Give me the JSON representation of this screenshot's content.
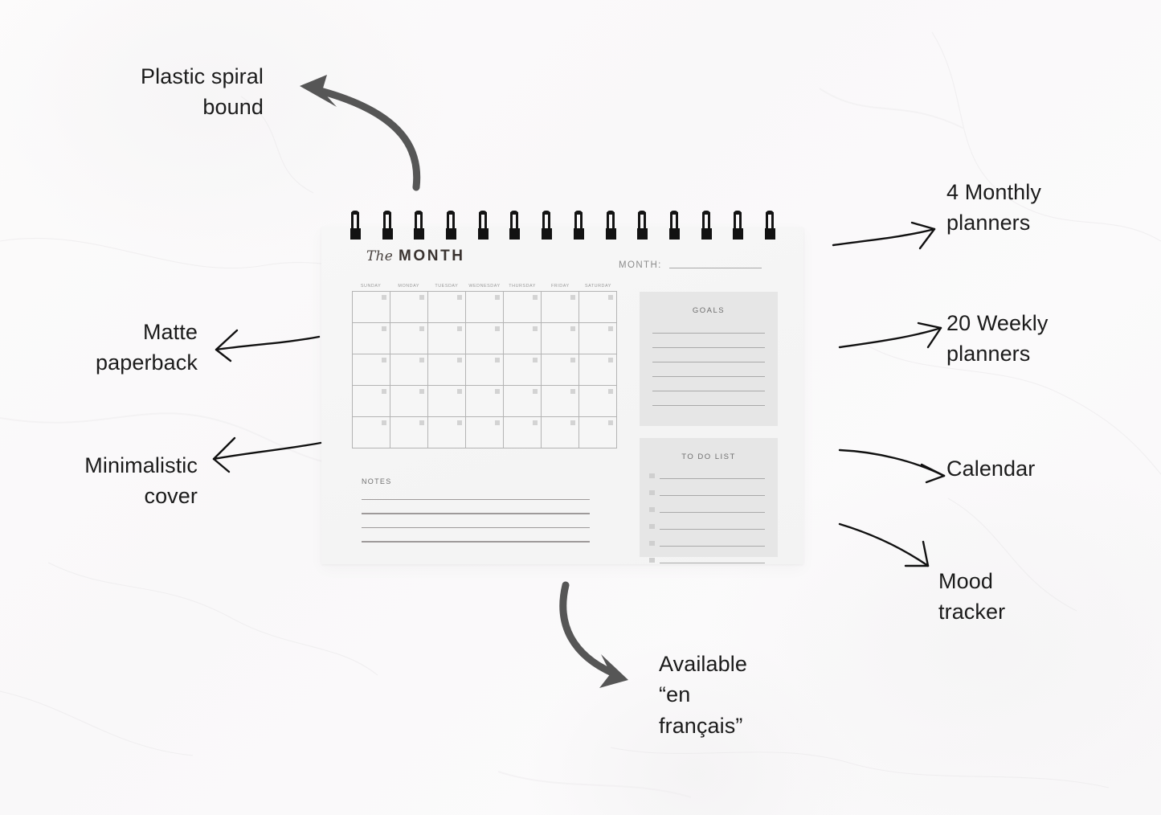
{
  "page": {
    "background_color": "#fbfafa",
    "card_background": "#f5f5f5",
    "panel_background": "#e6e6e6",
    "ink_color": "#1b1b1b",
    "thick_arrow_color": "#565656",
    "thin_arrow_color": "#111111"
  },
  "planner": {
    "title_script": "The",
    "title_bold": "MONTH",
    "month_field": {
      "label": "MONTH:",
      "value": ""
    },
    "calendar": {
      "day_headers": [
        "SUNDAY",
        "MONDAY",
        "TUESDAY",
        "WEDNESDAY",
        "THURSDAY",
        "FRIDAY",
        "SATURDAY"
      ],
      "rows": 5,
      "columns": 7,
      "cells_total": 35,
      "cell_values": [
        "",
        "",
        "",
        "",
        "",
        "",
        "",
        "",
        "",
        "",
        "",
        "",
        "",
        "",
        "",
        "",
        "",
        "",
        "",
        "",
        "",
        "",
        "",
        "",
        "",
        "",
        "",
        "",
        "",
        "",
        "",
        "",
        "",
        "",
        ""
      ]
    },
    "notes": {
      "label": "NOTES",
      "line_count": 4,
      "values": [
        "",
        "",
        "",
        ""
      ]
    },
    "goals": {
      "title": "GOALS",
      "line_count": 6,
      "values": [
        "",
        "",
        "",
        "",
        "",
        ""
      ]
    },
    "todo": {
      "title": "TO DO LIST",
      "line_count": 6,
      "items": [
        {
          "checked": false,
          "text": ""
        },
        {
          "checked": false,
          "text": ""
        },
        {
          "checked": false,
          "text": ""
        },
        {
          "checked": false,
          "text": ""
        },
        {
          "checked": false,
          "text": ""
        },
        {
          "checked": false,
          "text": ""
        }
      ]
    },
    "binding": {
      "type": "plastic-spiral",
      "coil_count": 14
    }
  },
  "annotations": {
    "plastic_spiral": "Plastic spiral\nbound",
    "matte_paperback": "Matte\npaperback",
    "minimalistic_cover": "Minimalistic\ncover",
    "monthly_planners": "4 Monthly\nplanners",
    "weekly_planners": "20 Weekly\nplanners",
    "calendar": "Calendar",
    "mood_tracker": "Mood\ntracker",
    "available_french": "Available\n“en\nfrançais”"
  }
}
